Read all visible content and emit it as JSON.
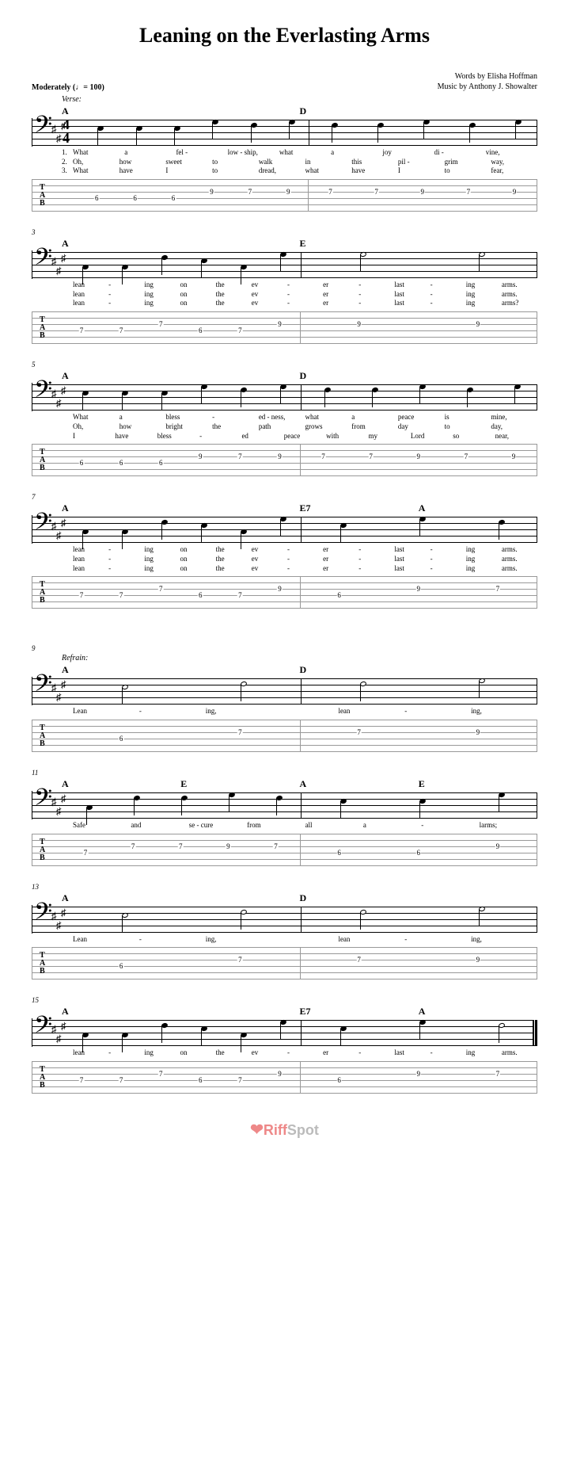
{
  "title": "Leaning on the Everlasting Arms",
  "tempo": "Moderately  (♩= 100)",
  "credits": {
    "words": "Words by Elisha Hoffman",
    "music": "Music by Anthony J. Showalter"
  },
  "sections": {
    "verse": "Verse:",
    "refrain": "Refrain:"
  },
  "watermark_brand": "RiffSpot",
  "chart_data": {
    "type": "table",
    "key": "A major",
    "clef": "bass",
    "time_signature": "4/4",
    "systems": [
      {
        "measure_start": 1,
        "chords": [
          "A",
          "",
          "D",
          ""
        ],
        "tab": [
          [
            {
              "s": 4,
              "f": 6
            },
            {
              "s": 4,
              "f": 6
            },
            {
              "s": 4,
              "f": 6
            },
            {
              "s": 3,
              "f": 9
            },
            {
              "s": 3,
              "f": 7
            },
            {
              "s": 3,
              "f": 9
            }
          ],
          [
            {
              "s": 3,
              "f": 7
            },
            {
              "s": 3,
              "f": 7
            },
            {
              "s": 3,
              "f": 9
            },
            {
              "s": 3,
              "f": 7
            },
            {
              "s": 3,
              "f": 9
            }
          ]
        ],
        "lyrics": [
          [
            "1.",
            "What",
            "a",
            "fel -",
            "low - ship,",
            "what",
            "a",
            "joy",
            "di -",
            "vine,"
          ],
          [
            "2.",
            "Oh,",
            "how",
            "sweet",
            "to",
            "walk",
            "in",
            "this",
            "pil -",
            "grim",
            "way,"
          ],
          [
            "3.",
            "What",
            "have",
            "I",
            "to",
            "dread,",
            "what",
            "have",
            "I",
            "to",
            "fear,"
          ]
        ]
      },
      {
        "measure_start": 3,
        "chords": [
          "A",
          "",
          "E",
          ""
        ],
        "tab": [
          [
            {
              "s": 4,
              "f": 7
            },
            {
              "s": 4,
              "f": 7
            },
            {
              "s": 3,
              "f": 7
            },
            {
              "s": 4,
              "f": 6
            },
            {
              "s": 4,
              "f": 7
            },
            {
              "s": 3,
              "f": 9
            }
          ],
          [
            {
              "s": 3,
              "f": 9
            },
            {
              "s": 3,
              "f": 9
            }
          ]
        ],
        "lyrics": [
          [
            "",
            "lean",
            "-",
            "ing",
            "on",
            "the",
            "ev",
            "-",
            "er",
            "-",
            "last",
            "-",
            "ing",
            "arms."
          ],
          [
            "",
            "lean",
            "-",
            "ing",
            "on",
            "the",
            "ev",
            "-",
            "er",
            "-",
            "last",
            "-",
            "ing",
            "arms."
          ],
          [
            "",
            "lean",
            "-",
            "ing",
            "on",
            "the",
            "ev",
            "-",
            "er",
            "-",
            "last",
            "-",
            "ing",
            "arms?"
          ]
        ]
      },
      {
        "measure_start": 5,
        "chords": [
          "A",
          "",
          "D",
          ""
        ],
        "tab": [
          [
            {
              "s": 4,
              "f": 6
            },
            {
              "s": 4,
              "f": 6
            },
            {
              "s": 4,
              "f": 6
            },
            {
              "s": 3,
              "f": 9
            },
            {
              "s": 3,
              "f": 7
            },
            {
              "s": 3,
              "f": 9
            }
          ],
          [
            {
              "s": 3,
              "f": 7
            },
            {
              "s": 3,
              "f": 7
            },
            {
              "s": 3,
              "f": 9
            },
            {
              "s": 3,
              "f": 7
            },
            {
              "s": 3,
              "f": 9
            }
          ]
        ],
        "lyrics": [
          [
            "",
            "What",
            "a",
            "bless",
            "-",
            "ed - ness,",
            "what",
            "a",
            "peace",
            "is",
            "mine,"
          ],
          [
            "",
            "Oh,",
            "how",
            "bright",
            "the",
            "path",
            "grows",
            "from",
            "day",
            "to",
            "day,"
          ],
          [
            "",
            "I",
            "have",
            "bless",
            "-",
            "ed",
            "peace",
            "with",
            "my",
            "Lord",
            "so",
            "near,"
          ]
        ]
      },
      {
        "measure_start": 7,
        "chords": [
          "A",
          "",
          "E7",
          "A"
        ],
        "tab": [
          [
            {
              "s": 4,
              "f": 7
            },
            {
              "s": 4,
              "f": 7
            },
            {
              "s": 3,
              "f": 7
            },
            {
              "s": 4,
              "f": 6
            },
            {
              "s": 4,
              "f": 7
            },
            {
              "s": 3,
              "f": 9
            }
          ],
          [
            {
              "s": 4,
              "f": 6
            },
            {
              "s": 3,
              "f": 9
            },
            {
              "s": 3,
              "f": 7
            }
          ]
        ],
        "lyrics": [
          [
            "",
            "lean",
            "-",
            "ing",
            "on",
            "the",
            "ev",
            "-",
            "er",
            "-",
            "last",
            "-",
            "ing",
            "arms."
          ],
          [
            "",
            "lean",
            "-",
            "ing",
            "on",
            "the",
            "ev",
            "-",
            "er",
            "-",
            "last",
            "-",
            "ing",
            "arms."
          ],
          [
            "",
            "lean",
            "-",
            "ing",
            "on",
            "the",
            "ev",
            "-",
            "er",
            "-",
            "last",
            "-",
            "ing",
            "arms."
          ]
        ]
      },
      {
        "measure_start": 9,
        "section": "refrain",
        "chords": [
          "A",
          "",
          "D",
          ""
        ],
        "tab": [
          [
            {
              "s": 4,
              "f": 6
            },
            {
              "s": 3,
              "f": 7
            }
          ],
          [
            {
              "s": 3,
              "f": 7
            },
            {
              "s": 3,
              "f": 9
            }
          ]
        ],
        "lyrics": [
          [
            "",
            "Lean",
            "-",
            "ing,",
            "",
            "lean",
            "-",
            "ing,"
          ]
        ]
      },
      {
        "measure_start": 11,
        "chords": [
          "A",
          "E",
          "A",
          "E"
        ],
        "tab": [
          [
            {
              "s": 4,
              "f": 7
            },
            {
              "s": 3,
              "f": 7
            },
            {
              "s": 3,
              "f": 7
            },
            {
              "s": 3,
              "f": 9
            },
            {
              "s": 3,
              "f": 7
            }
          ],
          [
            {
              "s": 4,
              "f": 6
            },
            {
              "s": 4,
              "f": 6
            },
            {
              "s": 3,
              "f": 9
            }
          ]
        ],
        "lyrics": [
          [
            "",
            "Safe",
            "and",
            "se - cure",
            "from",
            "all",
            "a",
            "-",
            "larms;"
          ]
        ]
      },
      {
        "measure_start": 13,
        "chords": [
          "A",
          "",
          "D",
          ""
        ],
        "tab": [
          [
            {
              "s": 4,
              "f": 6
            },
            {
              "s": 3,
              "f": 7
            }
          ],
          [
            {
              "s": 3,
              "f": 7
            },
            {
              "s": 3,
              "f": 9
            }
          ]
        ],
        "lyrics": [
          [
            "",
            "Lean",
            "-",
            "ing,",
            "",
            "lean",
            "-",
            "ing,"
          ]
        ]
      },
      {
        "measure_start": 15,
        "chords": [
          "A",
          "",
          "E7",
          "A"
        ],
        "tab": [
          [
            {
              "s": 4,
              "f": 7
            },
            {
              "s": 4,
              "f": 7
            },
            {
              "s": 3,
              "f": 7
            },
            {
              "s": 4,
              "f": 6
            },
            {
              "s": 4,
              "f": 7
            },
            {
              "s": 3,
              "f": 9
            }
          ],
          [
            {
              "s": 4,
              "f": 6
            },
            {
              "s": 3,
              "f": 9
            },
            {
              "s": 3,
              "f": 7
            }
          ]
        ],
        "lyrics": [
          [
            "",
            "lean",
            "-",
            "ing",
            "on",
            "the",
            "ev",
            "-",
            "er",
            "-",
            "last",
            "-",
            "ing",
            "arms."
          ]
        ]
      }
    ]
  }
}
